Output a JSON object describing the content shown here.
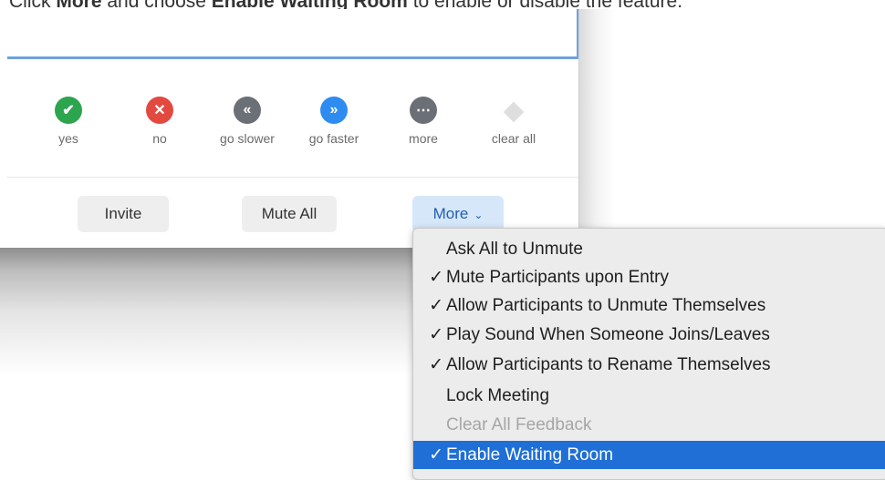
{
  "instruction": {
    "prefix": "Click ",
    "more_bold": "More",
    "middle": " and choose ",
    "ewr_bold": "Enable Waiting Room",
    "suffix": " to enable or disable the feature."
  },
  "reactions": [
    {
      "label": "yes",
      "icon": "check-icon",
      "glyph": "✔",
      "color": "#2da44e"
    },
    {
      "label": "no",
      "icon": "close-icon",
      "glyph": "✕",
      "color": "#e24a3f"
    },
    {
      "label": "go slower",
      "icon": "rewind-icon",
      "glyph": "«",
      "color": "#6b6f76"
    },
    {
      "label": "go faster",
      "icon": "fast-forward-icon",
      "glyph": "»",
      "color": "#2e8cf0"
    },
    {
      "label": "more",
      "icon": "ellipsis-icon",
      "glyph": "⋯",
      "color": "#6b6f76"
    },
    {
      "label": "clear all",
      "icon": "eraser-icon",
      "glyph": "",
      "color": "#dedede"
    }
  ],
  "buttons": {
    "invite": "Invite",
    "mute_all": "Mute All",
    "more": "More",
    "more_chevron": "⌄"
  },
  "menu": {
    "items": [
      {
        "label": "Ask All to Unmute",
        "check": "",
        "state": "normal"
      },
      {
        "label": "Mute Participants upon Entry",
        "check": "✓",
        "state": "normal"
      },
      {
        "label": "Allow Participants to Unmute Themselves",
        "check": "✓",
        "state": "normal"
      },
      {
        "label": "Play Sound When Someone Joins/Leaves",
        "check": "✓",
        "state": "normal"
      },
      {
        "label": "Allow Participants to Rename Themselves",
        "check": "✓",
        "state": "normal"
      },
      {
        "label": "Lock Meeting",
        "check": "",
        "state": "normal"
      },
      {
        "label": "Clear All Feedback",
        "check": "",
        "state": "disabled"
      },
      {
        "label": "Enable Waiting Room",
        "check": "✓",
        "state": "selected"
      }
    ]
  },
  "colors": {
    "accent": "#1f6fd6",
    "more_button_bg": "#d7e7fa"
  }
}
